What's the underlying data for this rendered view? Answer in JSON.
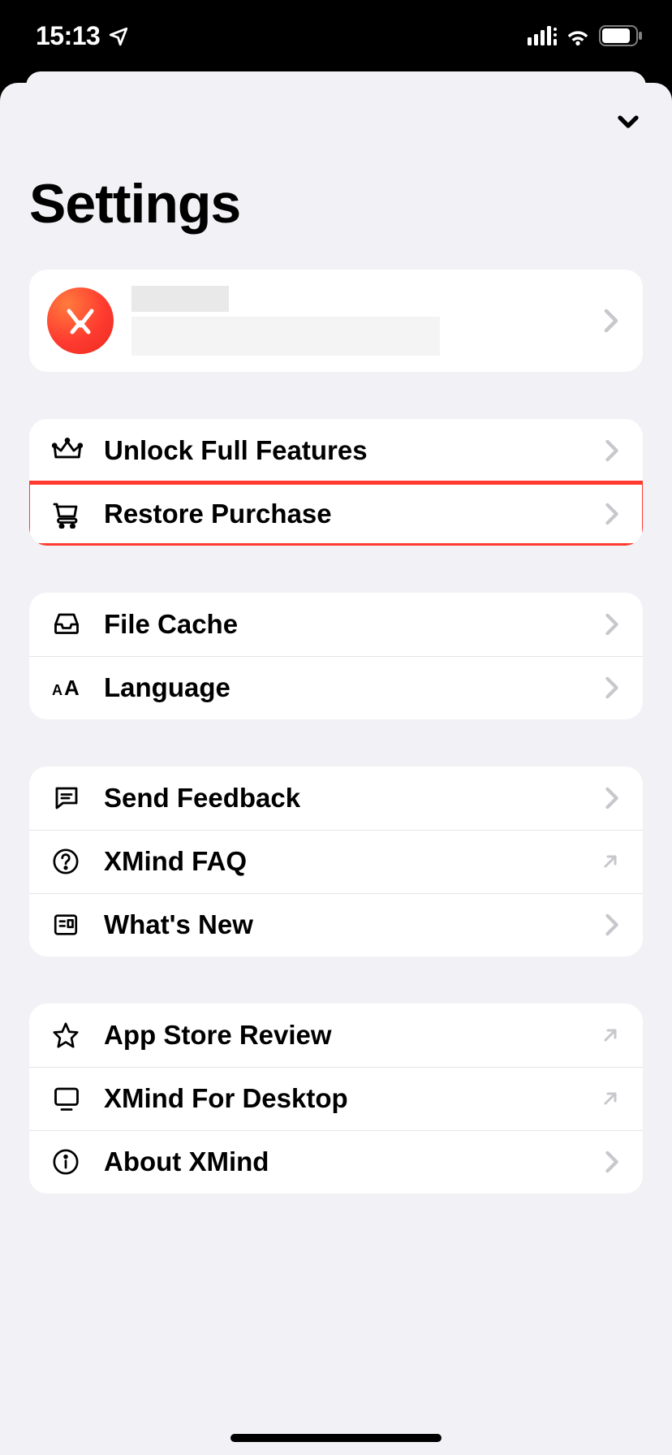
{
  "statusBar": {
    "time": "15:13"
  },
  "page": {
    "title": "Settings"
  },
  "profile": {
    "name_line1": "",
    "name_line2": ""
  },
  "group1": {
    "unlock": "Unlock Full Features",
    "restore": "Restore Purchase"
  },
  "group2": {
    "fileCache": "File Cache",
    "language": "Language"
  },
  "group3": {
    "feedback": "Send Feedback",
    "faq": "XMind FAQ",
    "whatsNew": "What's New"
  },
  "group4": {
    "review": "App Store Review",
    "desktop": "XMind For Desktop",
    "about": "About XMind"
  }
}
